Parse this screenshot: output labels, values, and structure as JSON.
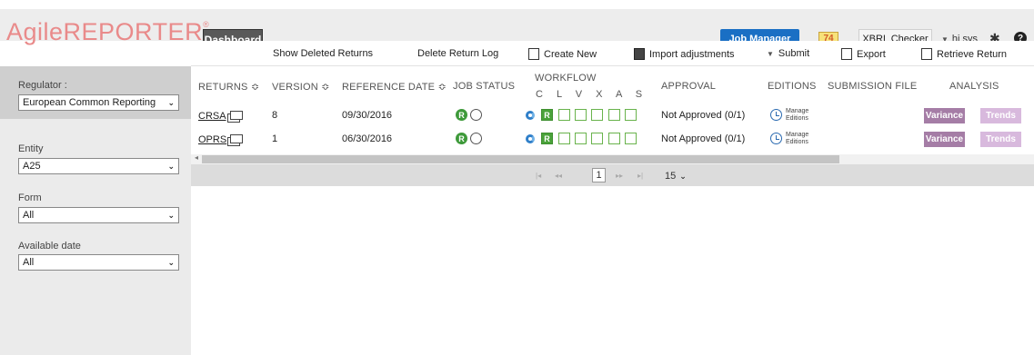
{
  "header": {
    "logo_text": "AgileREPORTER",
    "logo_mark": "®",
    "dashboard_label": "Dashboard",
    "job_manager_label": "Job Manager",
    "notification_count": "74",
    "xbrl_checker_label": "XBRL Checker",
    "user_label": "hi sys",
    "help_label": "?"
  },
  "toolbar": {
    "show_deleted": "Show Deleted Returns",
    "delete_log": "Delete Return Log",
    "create_new": "Create New",
    "import_adjustments": "Import adjustments",
    "submit": "Submit",
    "export": "Export",
    "retrieve_return": "Retrieve Return"
  },
  "sidebar": {
    "regulator_label": "Regulator :",
    "regulator_value": "European Common Reporting",
    "entity_label": "Entity",
    "entity_value": "A25",
    "form_label": "Form",
    "form_value": "All",
    "available_date_label": "Available date",
    "available_date_value": "All"
  },
  "table": {
    "columns": {
      "returns": "RETURNS ≎",
      "version": "VERSION ≎",
      "reference_date": "REFERENCE DATE ≎",
      "job_status": "JOB STATUS",
      "workflow": "WORKFLOW",
      "workflow_letters": "C L V X A S",
      "approval": "APPROVAL",
      "editions": "EDITIONS",
      "submission_file": "SUBMISSION FILE",
      "analysis": "ANALYSIS"
    },
    "rows": [
      {
        "return": "CRSA",
        "version": "8",
        "reference_date": "09/30/2016",
        "job_status_badge": "R",
        "workflow_active": "R",
        "approval": "Not Approved (0/1)",
        "manage_line1": "Manage",
        "manage_line2": "Editions",
        "variance": "Variance",
        "trends": "Trends"
      },
      {
        "return": "OPRS",
        "version": "1",
        "reference_date": "06/30/2016",
        "job_status_badge": "R",
        "workflow_active": "R",
        "approval": "Not Approved (0/1)",
        "manage_line1": "Manage",
        "manage_line2": "Editions",
        "variance": "Variance",
        "trends": "Trends"
      }
    ]
  },
  "pager": {
    "first": "|◂",
    "prev": "◂◂",
    "page": "1",
    "next": "▸▸",
    "last": "▸|",
    "page_size": "15"
  },
  "colors": {
    "logo": "#e98a8a",
    "job_manager": "#1a6fc4",
    "status_green": "#3e9a3a",
    "variance": "#a57da6",
    "trends": "#d8b9dd"
  }
}
